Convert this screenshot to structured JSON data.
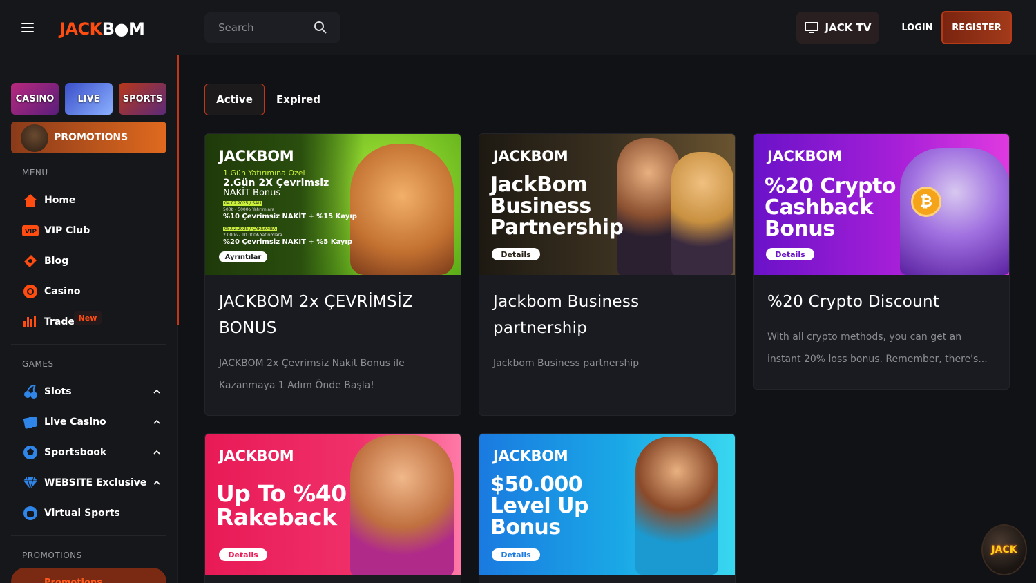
{
  "header": {
    "logo_part1": "JACK",
    "logo_part2": "B",
    "logo_part3": "M",
    "search_placeholder": "Search",
    "jacktv_label": "JACK TV",
    "login_label": "LOGIN",
    "register_label": "REGISTER"
  },
  "sidebar": {
    "tiles": {
      "casino": "CASINO",
      "live": "LIVE",
      "sports": "SPORTS"
    },
    "promotions_button": "PROMOTIONS",
    "menu_label": "MENU",
    "menu": [
      {
        "label": "Home",
        "icon": "home-icon"
      },
      {
        "label": "VIP Club",
        "icon": "vip-icon"
      },
      {
        "label": "Blog",
        "icon": "blog-icon"
      },
      {
        "label": "Casino",
        "icon": "casino-chip-icon"
      },
      {
        "label": "Trade",
        "icon": "chart-bars-icon"
      }
    ],
    "new_badge": "New",
    "games_label": "GAMES",
    "games": [
      {
        "label": "Slots",
        "icon": "cherry-icon"
      },
      {
        "label": "Live Casino",
        "icon": "cards-icon"
      },
      {
        "label": "Sportsbook",
        "icon": "ball-icon"
      },
      {
        "label": "WEBSITE Exclusive",
        "icon": "diamond-icon"
      },
      {
        "label": "Virtual Sports",
        "icon": "virtual-sports-icon"
      }
    ],
    "promotions_label": "PROMOTIONS",
    "promotions_item": "Promotions"
  },
  "tabs": {
    "active": "Active",
    "expired": "Expired"
  },
  "cards": [
    {
      "title": "JACKBOM 2x ÇEVRİMSİZ BONUS",
      "description": "JACKBOM 2x Çevrimsiz Nakit Bonus ile Kazanmaya 1 Adım Önde Başla!",
      "banner": {
        "brand": "JACKBOM",
        "line1": "1.Gün Yatırımına Özel",
        "line2": "2.Gün 2X Çevrimsiz",
        "line3": "NAKİT Bonus",
        "date1": "04.02.2025 / SALI",
        "range1": "500₺ - 5000₺ Yatırımlara",
        "offer1": "%10 Çevrimsiz NAKİT + %15 Kayıp",
        "date2": "05.02.2025 / ÇARŞAMBA",
        "range2": "2.000₺ - 10.000₺ Yatırımlara",
        "offer2": "%20 Çevrimsiz NAKİT + %5 Kayıp",
        "button": "Ayrıntılar",
        "bg": "#6fc61a"
      }
    },
    {
      "title": "Jackbom Business partnership",
      "description": "Jackbom Business partnership",
      "banner": {
        "brand": "JACKBOM",
        "heading": "JackBom Business Partnership",
        "button": "Details",
        "bg": "#2a2116"
      }
    },
    {
      "title": "%20 Crypto Discount",
      "description": "With all crypto methods, you can get an instant 20% loss bonus. Remember, there's...",
      "banner": {
        "brand": "JACKBOM",
        "heading": "%20 Crypto Cashback Bonus",
        "button": "Details",
        "bg": "#8a1fd1"
      }
    },
    {
      "banner": {
        "brand": "JACKBOM",
        "heading": "Up To %40 Rakeback",
        "button": "Details",
        "bg": "#f0245e"
      }
    },
    {
      "banner": {
        "brand": "JACKBOM",
        "heading": "$50.000 Level Up Bonus",
        "button": "Details",
        "bg": "#1aa8e6"
      }
    }
  ],
  "floating_button": "JACK",
  "colors": {
    "accent": "#ff4d12",
    "background": "#111216",
    "panel": "#16171b",
    "card": "#1a1b20"
  }
}
